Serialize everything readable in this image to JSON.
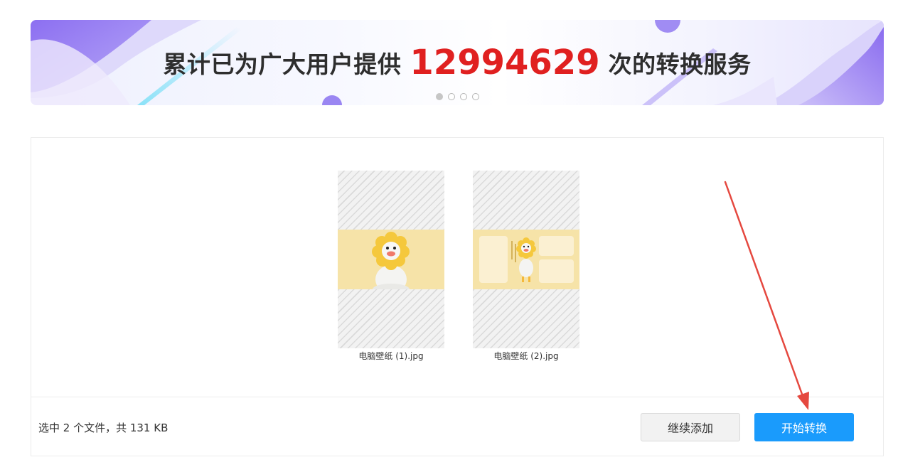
{
  "banner": {
    "prefix": "累计已为广大用户提供",
    "count": "12994629",
    "suffix": "次的转换服务",
    "count_color": "#e02020",
    "carousel_dots": 4,
    "active_dot": 0
  },
  "files": [
    {
      "name": "电脑壁纸 (1).jpg"
    },
    {
      "name": "电脑壁纸 (2).jpg"
    }
  ],
  "footer": {
    "summary": "选中 2 个文件，共 131 KB",
    "add_more_label": "继续添加",
    "start_label": "开始转换"
  },
  "colors": {
    "primary_button": "#1a9bfc",
    "annotation_arrow": "#e5483f",
    "banner_accent": "#8b6ff0"
  }
}
